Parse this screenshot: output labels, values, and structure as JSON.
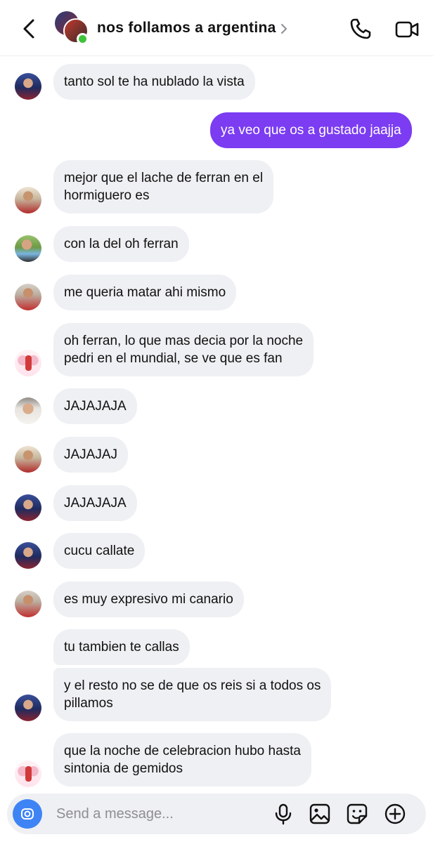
{
  "header": {
    "title": "nos follamos a argentina",
    "icons": {
      "back": "chevron-left-icon",
      "title_chevron": "chevron-right-icon",
      "call": "phone-icon",
      "video": "video-camera-icon"
    },
    "online_color": "#3ec23a"
  },
  "colors": {
    "outgoing_bubble": "#7b3cf2",
    "incoming_bubble": "#eff0f3",
    "camera_button": "#3e84f5"
  },
  "messages": [
    {
      "direction": "in",
      "lines": [
        "tanto sol te ha nublado la vista"
      ]
    },
    {
      "direction": "out",
      "lines": [
        "ya veo que os a gustado jaajja"
      ]
    },
    {
      "direction": "in",
      "lines": [
        "mejor que el lache de ferran en el",
        "hormiguero es"
      ]
    },
    {
      "direction": "in",
      "lines": [
        "con la del oh ferran"
      ]
    },
    {
      "direction": "in",
      "lines": [
        "me queria matar ahi mismo"
      ]
    },
    {
      "direction": "in",
      "lines": [
        "oh ferran, lo que mas decia por la noche",
        "pedri en el mundial, se ve que es fan"
      ]
    },
    {
      "direction": "in",
      "lines": [
        "JAJAJAJA"
      ]
    },
    {
      "direction": "in",
      "lines": [
        "JAJAJAJ"
      ]
    },
    {
      "direction": "in",
      "lines": [
        "JAJAJAJA"
      ]
    },
    {
      "direction": "in",
      "lines": [
        "cucu callate"
      ]
    },
    {
      "direction": "in",
      "lines": [
        "es muy expresivo mi canario"
      ]
    },
    {
      "direction": "in",
      "lines": [
        "tu tambien te callas"
      ]
    },
    {
      "direction": "in",
      "lines": [
        "y el resto no se de que os reis si a todos os",
        "pillamos"
      ]
    },
    {
      "direction": "in",
      "lines": [
        "que la noche de celebracion hubo hasta",
        "sintonia de gemidos"
      ]
    }
  ],
  "composer": {
    "placeholder": "Send a message...",
    "icons": {
      "camera": "camera-icon",
      "mic": "microphone-icon",
      "gallery": "image-icon",
      "sticker": "sticker-icon",
      "more": "plus-circle-icon"
    }
  }
}
